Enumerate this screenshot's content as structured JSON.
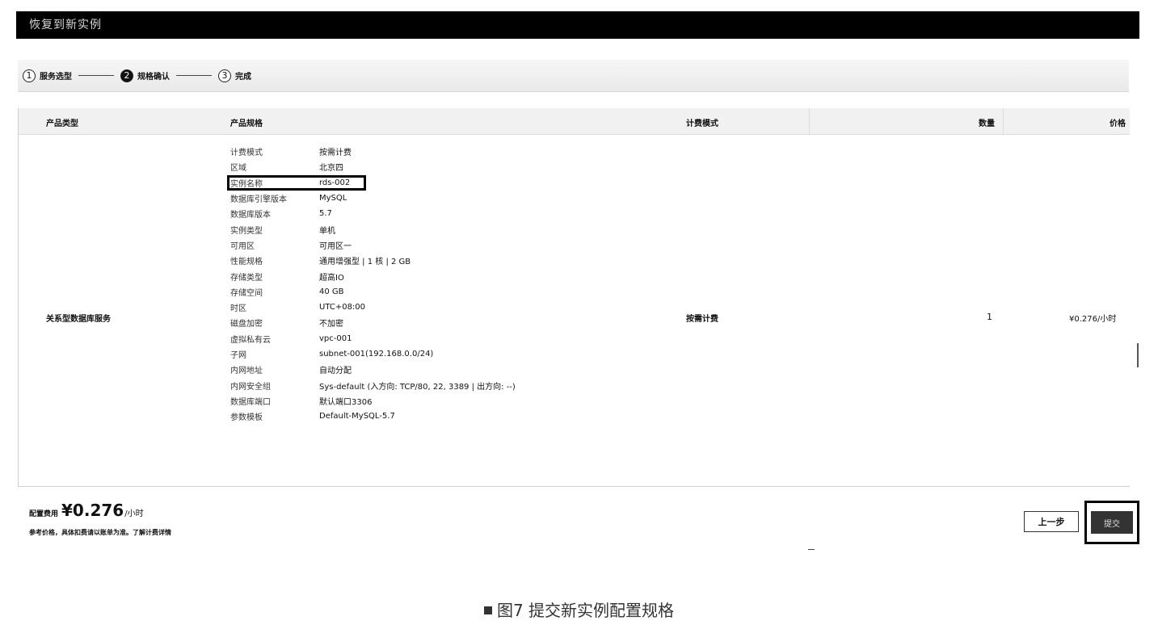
{
  "window": {
    "title": "恢复到新实例"
  },
  "steps": [
    {
      "number": "1",
      "label": "服务选型"
    },
    {
      "number": "2",
      "label": "规格确认"
    },
    {
      "number": "3",
      "label": "完成"
    }
  ],
  "table": {
    "headers": {
      "product_type": "产品类型",
      "product_spec": "产品规格",
      "billing_mode": "计费模式",
      "quantity": "数量",
      "price": "价格"
    },
    "row": {
      "product_type": "关系型数据库服务",
      "billing_mode": "按需计费",
      "quantity": "1",
      "price": "¥0.276/小时",
      "specs": [
        {
          "key": "计费模式",
          "value": "按需计费"
        },
        {
          "key": "区域",
          "value": "北京四"
        },
        {
          "key": "实例名称",
          "value": "rds-002"
        },
        {
          "key": "数据库引擎版本",
          "value": "MySQL"
        },
        {
          "key": "数据库版本",
          "value": "5.7"
        },
        {
          "key": "实例类型",
          "value": "单机"
        },
        {
          "key": "可用区",
          "value": "可用区一"
        },
        {
          "key": "性能规格",
          "value": "通用增强型 | 1 核 | 2 GB"
        },
        {
          "key": "存储类型",
          "value": "超高IO"
        },
        {
          "key": "存储空间",
          "value": "40 GB"
        },
        {
          "key": "时区",
          "value": "UTC+08:00"
        },
        {
          "key": "磁盘加密",
          "value": "不加密"
        },
        {
          "key": "虚拟私有云",
          "value": "vpc-001"
        },
        {
          "key": "子网",
          "value": "subnet-001(192.168.0.0/24)"
        },
        {
          "key": "内网地址",
          "value": "自动分配"
        },
        {
          "key": "内网安全组",
          "value": "Sys-default (入方向: TCP/80, 22, 3389 | 出方向: --)"
        },
        {
          "key": "数据库端口",
          "value": "默认端口3306"
        },
        {
          "key": "参数模板",
          "value": "Default-MySQL-5.7"
        }
      ]
    }
  },
  "footer": {
    "fee_label": "配置费用",
    "fee_value": "¥0.276",
    "fee_unit": "/小时",
    "fee_note": "参考价格，具体扣费请以账单为准。了解计费详情",
    "prev_label": "上一步",
    "submit_label": "提交"
  },
  "caption": "图7 提交新实例配置规格"
}
